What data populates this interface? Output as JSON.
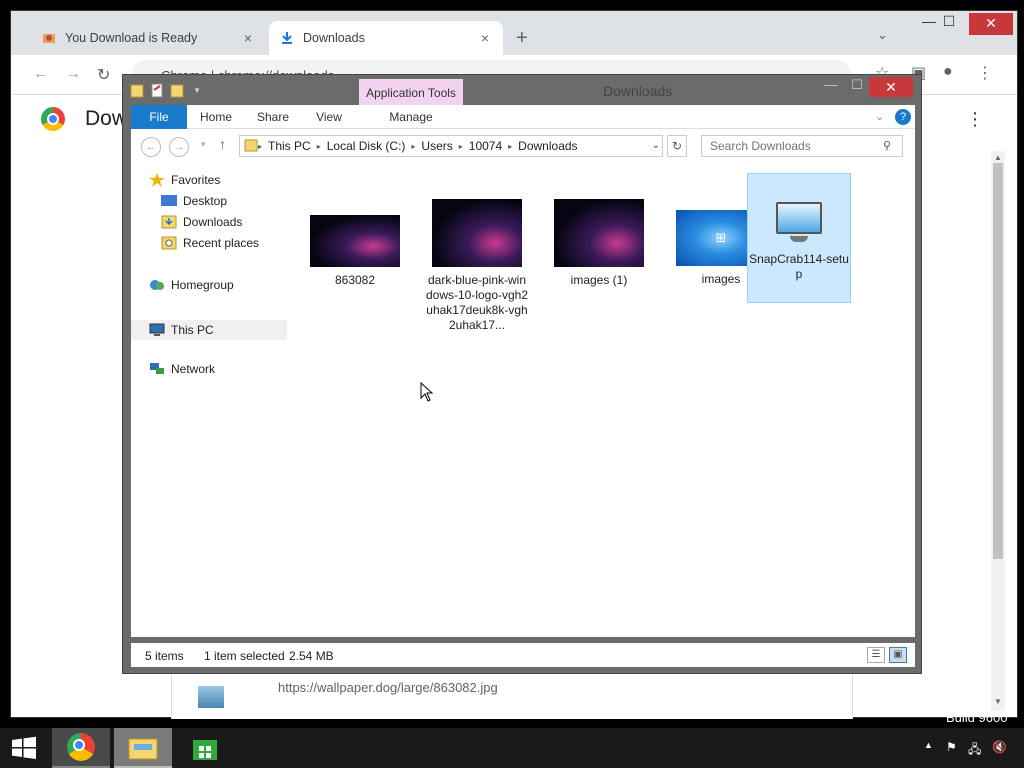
{
  "chrome": {
    "tabs": [
      {
        "label": "You Download is Ready",
        "close": "×"
      },
      {
        "label": "Downloads",
        "close": "×"
      }
    ],
    "new_tab": "+",
    "tab_search": "⌄",
    "omnibox_label": "Chrome",
    "omnibox_url": "chrome://downloads",
    "page_title": "Downloads",
    "download_url": "https://wallpaper.dog/large/863082.jpg"
  },
  "explorer": {
    "title": "Downloads",
    "contextual_tab": "Application Tools",
    "ribbon_tabs": [
      "File",
      "Home",
      "Share",
      "View",
      "Manage"
    ],
    "address_path": [
      "This PC",
      "Local Disk (C:)",
      "Users",
      "10074",
      "Downloads"
    ],
    "search_placeholder": "Search Downloads",
    "nav": {
      "favorites": "Favorites",
      "desktop": "Desktop",
      "downloads": "Downloads",
      "recent": "Recent places",
      "homegroup": "Homegroup",
      "this_pc": "This PC",
      "network": "Network"
    },
    "files": [
      {
        "name": "863082"
      },
      {
        "name": "dark-blue-pink-windows-10-logo-vgh2uhak17deuk8k-vgh2uhak17..."
      },
      {
        "name": "images (1)"
      },
      {
        "name": "images"
      },
      {
        "name": "SnapCrab114-setup"
      }
    ],
    "status_items": "5 items",
    "status_selected": "1 item selected",
    "status_size": "2.54 MB"
  },
  "desktop": {
    "build": "Build 9600"
  },
  "colors": {
    "explorer_file_tab": "#1979ca",
    "app_tools": "#f2d3f2",
    "close_red": "#c7383b",
    "selection": "#cce8ff"
  }
}
